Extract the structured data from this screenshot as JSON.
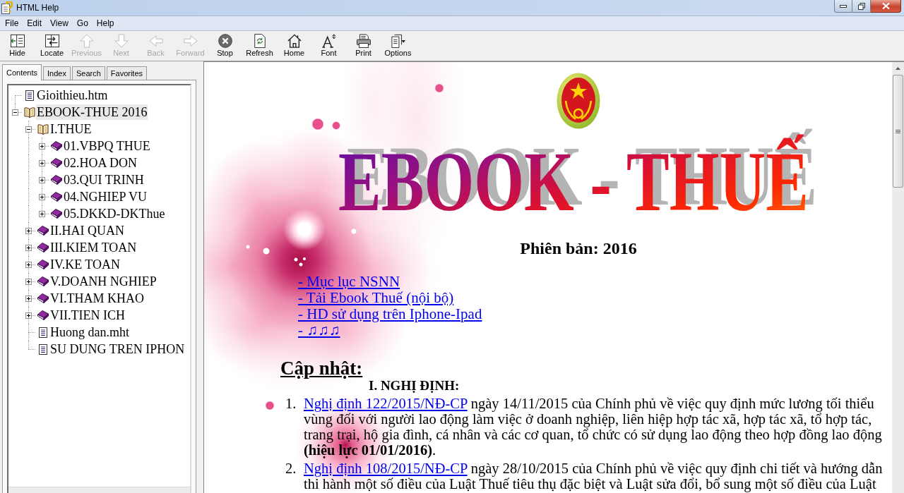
{
  "window": {
    "title": "HTML Help"
  },
  "menu": [
    "File",
    "Edit",
    "View",
    "Go",
    "Help"
  ],
  "toolbar": [
    {
      "label": "Hide",
      "kind": "hide",
      "disabled": false
    },
    {
      "label": "Locate",
      "kind": "locate",
      "disabled": false
    },
    {
      "label": "Previous",
      "kind": "previous",
      "disabled": true
    },
    {
      "label": "Next",
      "kind": "next",
      "disabled": true
    },
    {
      "label": "Back",
      "kind": "back",
      "disabled": true
    },
    {
      "label": "Forward",
      "kind": "forward",
      "disabled": true
    },
    {
      "label": "Stop",
      "kind": "stop",
      "disabled": false
    },
    {
      "label": "Refresh",
      "kind": "refresh",
      "disabled": false
    },
    {
      "label": "Home",
      "kind": "home",
      "disabled": false
    },
    {
      "label": "Font",
      "kind": "font",
      "disabled": false
    },
    {
      "label": "Print",
      "kind": "print",
      "disabled": false
    },
    {
      "label": "Options",
      "kind": "options",
      "disabled": false
    }
  ],
  "nav_tabs": [
    {
      "label": "Contents",
      "selected": true
    },
    {
      "label": "Index",
      "selected": false
    },
    {
      "label": "Search",
      "selected": false
    },
    {
      "label": "Favorites",
      "selected": false
    }
  ],
  "tree": [
    {
      "label": "Gioithieu.htm",
      "kind": "page",
      "selected": false
    },
    {
      "label": "EBOOK-THUE 2016",
      "kind": "book",
      "expanded": true,
      "selected": true,
      "children": [
        {
          "label": "I.THUE",
          "kind": "book",
          "expanded": true,
          "selected": false,
          "children": [
            {
              "label": "01.VBPQ THUE",
              "kind": "book",
              "expanded": false,
              "selected": false
            },
            {
              "label": "02.HOA DON",
              "kind": "book",
              "expanded": false,
              "selected": false
            },
            {
              "label": "03.QUI TRINH",
              "kind": "book",
              "expanded": false,
              "selected": false
            },
            {
              "label": "04.NGHIEP VU",
              "kind": "book",
              "expanded": false,
              "selected": false
            },
            {
              "label": "05.DKKD-DKThue",
              "kind": "book",
              "expanded": false,
              "selected": false
            }
          ]
        },
        {
          "label": "II.HAI QUAN",
          "kind": "book",
          "expanded": false,
          "selected": false
        },
        {
          "label": "III.KIEM TOAN",
          "kind": "book",
          "expanded": false,
          "selected": false
        },
        {
          "label": "IV.KE TOAN",
          "kind": "book",
          "expanded": false,
          "selected": false
        },
        {
          "label": "V.DOANH NGHIEP",
          "kind": "book",
          "expanded": false,
          "selected": false
        },
        {
          "label": "VI.THAM KHAO",
          "kind": "book",
          "expanded": false,
          "selected": false
        },
        {
          "label": "VII.TIEN ICH",
          "kind": "book",
          "expanded": false,
          "selected": false
        },
        {
          "label": "Huong dan.mht",
          "kind": "page",
          "selected": false
        },
        {
          "label": "SU DUNG TREN IPHON",
          "kind": "page",
          "selected": false
        }
      ]
    }
  ],
  "page": {
    "banner_title": "EBOOK - THUẾ",
    "version": "Phiên bản: 2016",
    "links": [
      "- Mục lục NSNN",
      "- Tải Ebook Thuế (nội bộ)",
      "- HD sử dụng trên Iphone-Ipad",
      "- ♫♫♫"
    ],
    "section_title": "Cập nhật:",
    "subsection_title": "I. NGHỊ ĐỊNH:",
    "items": [
      {
        "number": "1.",
        "link": "Nghị định 122/2015/NĐ-CP",
        "text": "ngày 14/11/2015 của Chính phủ về việc quy định mức lương tối thiểu vùng đối với người lao động làm việc ở doanh nghiệp, liên hiệp hợp tác xã, hợp tác xã, tổ hợp tác, trang trại, hộ gia đình, cá nhân và các cơ quan, tổ chức có sử dụng lao động theo hợp đồng lao động **(hiệu lực 01/01/2016)**."
      },
      {
        "number": "2.",
        "link": "Nghị định 108/2015/NĐ-CP",
        "text": "ngày 28/10/2015 của Chính phủ về việc quy định chi tiết và hướng dẫn thi hành một số điều của Luật Thuế tiêu thụ đặc biệt và Luật sửa đổi, bổ sung một số điều của Luật"
      }
    ]
  }
}
